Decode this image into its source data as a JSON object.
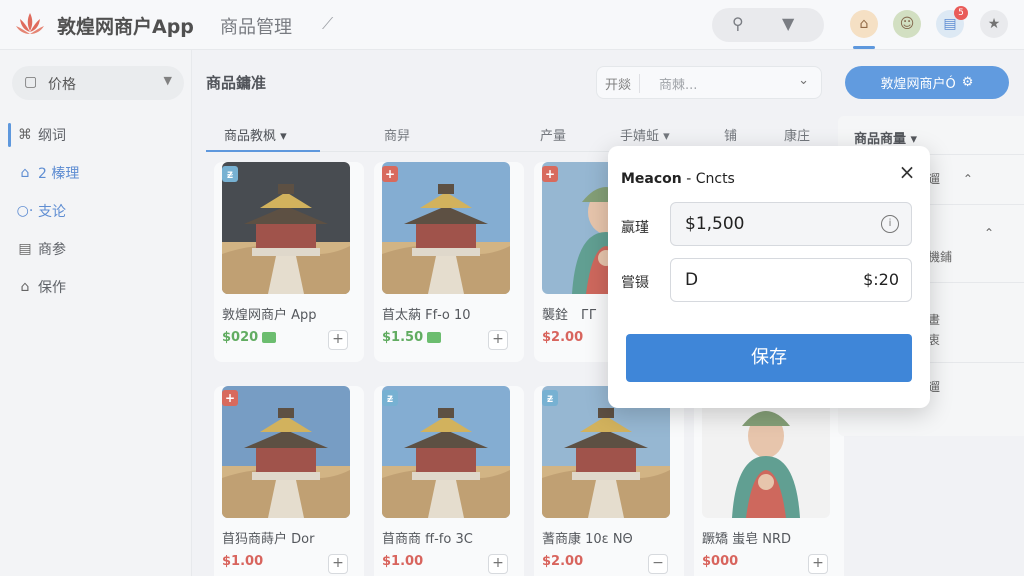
{
  "topbar": {
    "app_title": "敦煌网商户App",
    "section_title": "商品管理",
    "pin_icon": "pin-icon",
    "search_icon": "search-icon",
    "voice_icon": "microphone-icon",
    "notif_badge": "5",
    "accent": "#3b82d6"
  },
  "sidebar": {
    "price_dropdown": {
      "icon": "bag-icon",
      "label": "价格"
    },
    "items": [
      {
        "label": "纲词",
        "icon": "book-icon"
      },
      {
        "label": "2 榛理",
        "icon": "home-icon"
      },
      {
        "label": "支论",
        "icon": "dot-icon"
      },
      {
        "label": "商参",
        "icon": "doc-icon"
      },
      {
        "label": "保作",
        "icon": "house-icon"
      }
    ]
  },
  "main": {
    "title": "商品鏞准",
    "filter": {
      "tag": "开燚",
      "placeholder": "商棘..."
    },
    "top_button": "敦煌网商户Ó",
    "tabs": [
      "商品教枫",
      "商舁",
      "产量",
      "手婧蚯",
      "铺",
      "康庄"
    ],
    "cards": [
      {
        "name": "敦煌网商户 App",
        "price": "$020",
        "price_color": "green",
        "tag": "ᵶ",
        "tag_color": "#5aa0c8",
        "sky": "#20252b",
        "add": "+"
      },
      {
        "name": "苜太蒳 Ff‑o 10",
        "price": "$1.50",
        "price_color": "green",
        "tag": "+",
        "tag_color": "#d04a3a",
        "sky": "#6a9cc8",
        "add": "+"
      },
      {
        "name": "襲銓　ГГ　ᵰ̃",
        "price": "$2.00",
        "price_color": "red",
        "tag": "+",
        "tag_color": "#d04a3a",
        "sky": "#7fa8c9",
        "add": "+"
      },
      {
        "name": "苜犸商蒔户 Dor",
        "price": "$1.00",
        "price_color": "red",
        "tag": "+",
        "tag_color": "#d04a3a",
        "sky": "#5a88b8",
        "add": "+"
      },
      {
        "name": "苜商商 ff‑fo 3C",
        "price": "$1.00",
        "price_color": "red",
        "tag": "ᵶ",
        "tag_color": "#5aa0c8",
        "sky": "#6a9cc8",
        "add": "+"
      },
      {
        "name": "蓍商康 10ε ΝΘ",
        "price": "$2.00",
        "price_color": "red",
        "tag": "ᵶ",
        "tag_color": "#5aa0c8",
        "sky": "#7fa8c9",
        "add": "−"
      },
      {
        "name": "蹶矯 蚩皂 ΝRD",
        "price": "$000",
        "price_color": "red",
        "tag": "",
        "tag_color": "#ffffff",
        "sky": "#f0f0f0",
        "add": "+"
      }
    ]
  },
  "right_panel": {
    "title": "商品商量",
    "rows": [
      "遛",
      "機鋪",
      "畫　　　　衷",
      "遛"
    ]
  },
  "modal": {
    "title_bold": "Meacon",
    "title_rest": "- Cncts",
    "close": "×",
    "field1_label": "赢瑾",
    "field1_value": "$1,500",
    "field2_label": "嘗镊",
    "field2_value": "D",
    "field2_right": "$:20",
    "save_label": "保存"
  }
}
